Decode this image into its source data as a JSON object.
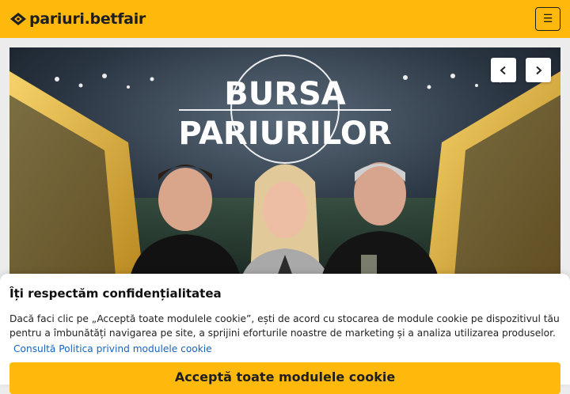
{
  "header": {
    "logo_text": "pariuri.betfair",
    "logo_icon": "betfair-logo-icon",
    "menu_icon": "hamburger-menu-icon",
    "menu_glyph": "☰",
    "brand_color": "#ffb80c"
  },
  "hero": {
    "banner_title_line1": "BURSA",
    "banner_title_line2": "PARIURILOR",
    "prev_icon": "chevron-left-icon",
    "next_icon": "chevron-right-icon"
  },
  "cookie_banner": {
    "title": "Îți respectăm confidențialitatea",
    "body": "Dacă faci clic pe „Acceptă toate modulele cookie”, ești de acord cu stocarea de module cookie pe dispozitivul tău pentru a îmbunătăți navigarea pe site, a sprijini eforturile noastre de marketing și a analiza utilizarea produselor.",
    "policy_link": "Consultă Politica privind modulele cookie",
    "accept_button": "Acceptă toate modulele cookie",
    "link_color": "#1565c0"
  }
}
